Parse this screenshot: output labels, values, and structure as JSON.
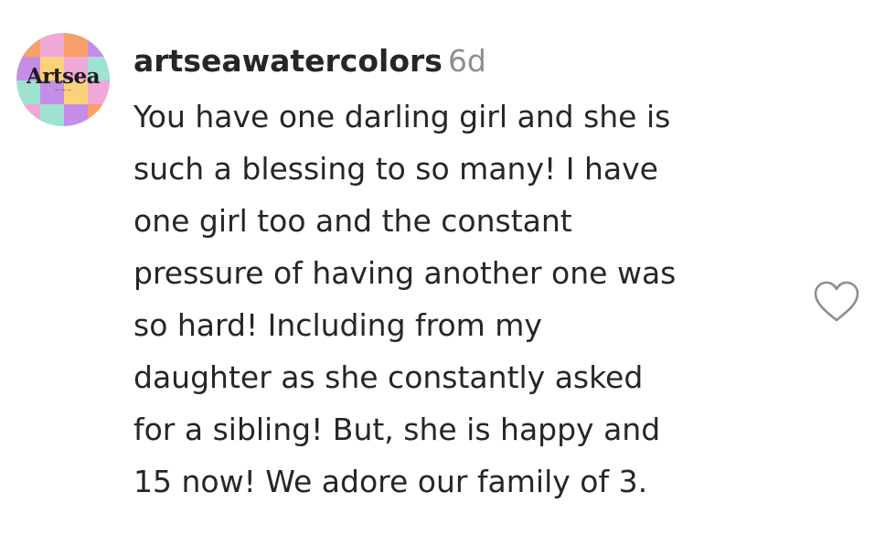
{
  "comment": {
    "avatar": {
      "brand_text": "Artsea",
      "icon": "avatar-logo",
      "colors": [
        "#f7a06a",
        "#c48ee8",
        "#f0a8d8",
        "#9de3d0",
        "#fbd27a"
      ]
    },
    "username": "artseawatercolors",
    "time": "6d",
    "lines": [
      "You have one darling girl and she is",
      "such a blessing to so many! I have",
      "one girl too and the constant",
      "pressure of having another one was",
      "so hard! Including from my",
      "daughter as she constantly asked",
      "for a sibling! But, she is happy and",
      "15 now! We adore our family of 3."
    ],
    "like_icon": "heart-icon"
  }
}
